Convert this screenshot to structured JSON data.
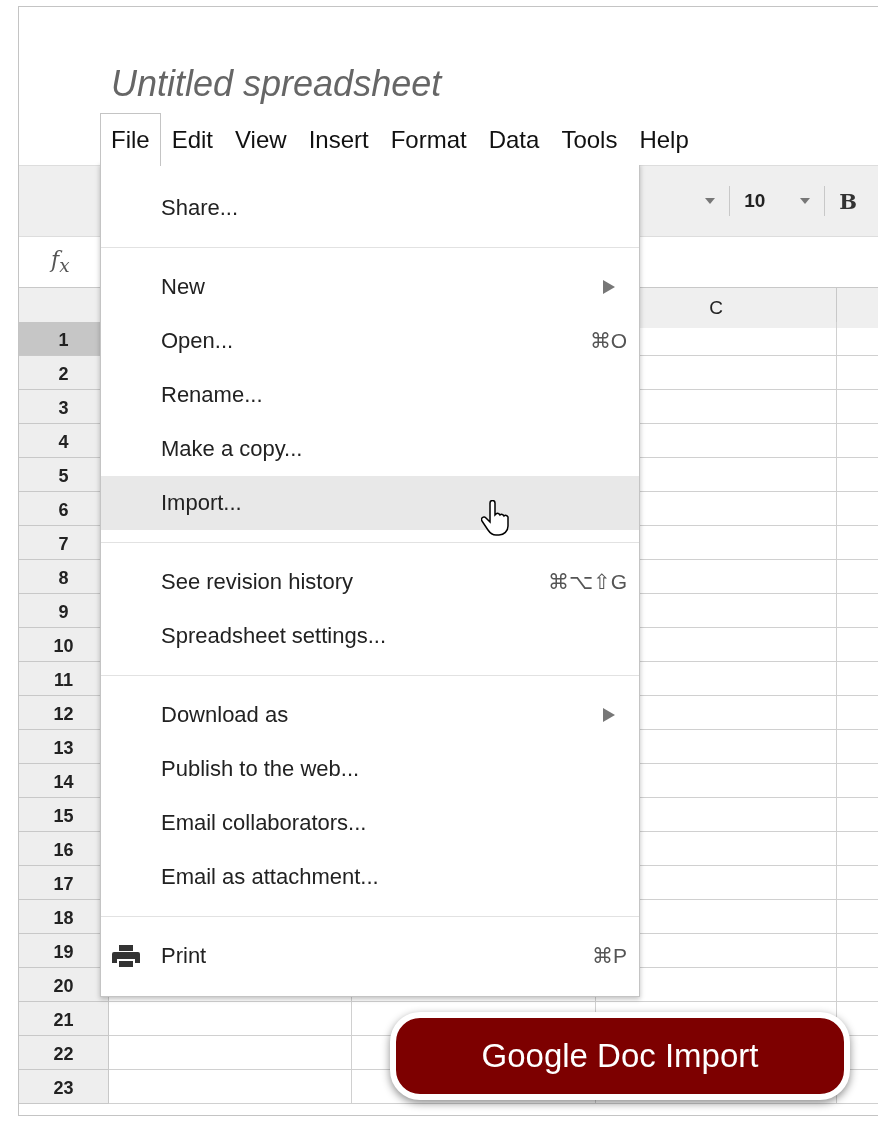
{
  "title": "Untitled spreadsheet",
  "menubar": [
    {
      "label": "File",
      "selected": true
    },
    {
      "label": "Edit",
      "selected": false
    },
    {
      "label": "View",
      "selected": false
    },
    {
      "label": "Insert",
      "selected": false
    },
    {
      "label": "Format",
      "selected": false
    },
    {
      "label": "Data",
      "selected": false
    },
    {
      "label": "Tools",
      "selected": false
    },
    {
      "label": "Help",
      "selected": false
    }
  ],
  "toolbar": {
    "font_size": "10",
    "bold": "B"
  },
  "formula_bar": {
    "label": "f$_{x}$"
  },
  "columns": [
    "C"
  ],
  "rows": [
    {
      "label": "1",
      "selected": true
    },
    {
      "label": "2",
      "selected": false
    },
    {
      "label": "3",
      "selected": false
    },
    {
      "label": "4",
      "selected": false
    },
    {
      "label": "5",
      "selected": false
    },
    {
      "label": "6",
      "selected": false
    },
    {
      "label": "7",
      "selected": false
    },
    {
      "label": "8",
      "selected": false
    },
    {
      "label": "9",
      "selected": false
    },
    {
      "label": "10",
      "selected": false
    },
    {
      "label": "11",
      "selected": false
    },
    {
      "label": "12",
      "selected": false
    },
    {
      "label": "13",
      "selected": false
    },
    {
      "label": "14",
      "selected": false
    },
    {
      "label": "15",
      "selected": false
    },
    {
      "label": "16",
      "selected": false
    },
    {
      "label": "17",
      "selected": false
    },
    {
      "label": "18",
      "selected": false
    },
    {
      "label": "19",
      "selected": false
    },
    {
      "label": "20",
      "selected": false
    },
    {
      "label": "21",
      "selected": false
    },
    {
      "label": "22",
      "selected": false
    },
    {
      "label": "23",
      "selected": false
    }
  ],
  "file_menu": [
    [
      {
        "label": "Share...",
        "highlighted": false
      }
    ],
    [
      {
        "label": "New",
        "submenu": true,
        "highlighted": false
      },
      {
        "label": "Open...",
        "shortcut": "⌘O",
        "highlighted": false
      },
      {
        "label": "Rename...",
        "highlighted": false
      },
      {
        "label": "Make a copy...",
        "highlighted": false
      },
      {
        "label": "Import...",
        "highlighted": true
      }
    ],
    [
      {
        "label": "See revision history",
        "shortcut": "⌘⌥⇧G",
        "highlighted": false
      },
      {
        "label": "Spreadsheet settings...",
        "highlighted": false
      }
    ],
    [
      {
        "label": "Download as",
        "submenu": true,
        "highlighted": false
      },
      {
        "label": "Publish to the web...",
        "highlighted": false
      },
      {
        "label": "Email collaborators...",
        "highlighted": false
      },
      {
        "label": "Email as attachment...",
        "highlighted": false
      }
    ],
    [
      {
        "label": "Print",
        "shortcut": "⌘P",
        "kind": "print",
        "highlighted": false
      }
    ]
  ],
  "callout": "Google Doc Import"
}
